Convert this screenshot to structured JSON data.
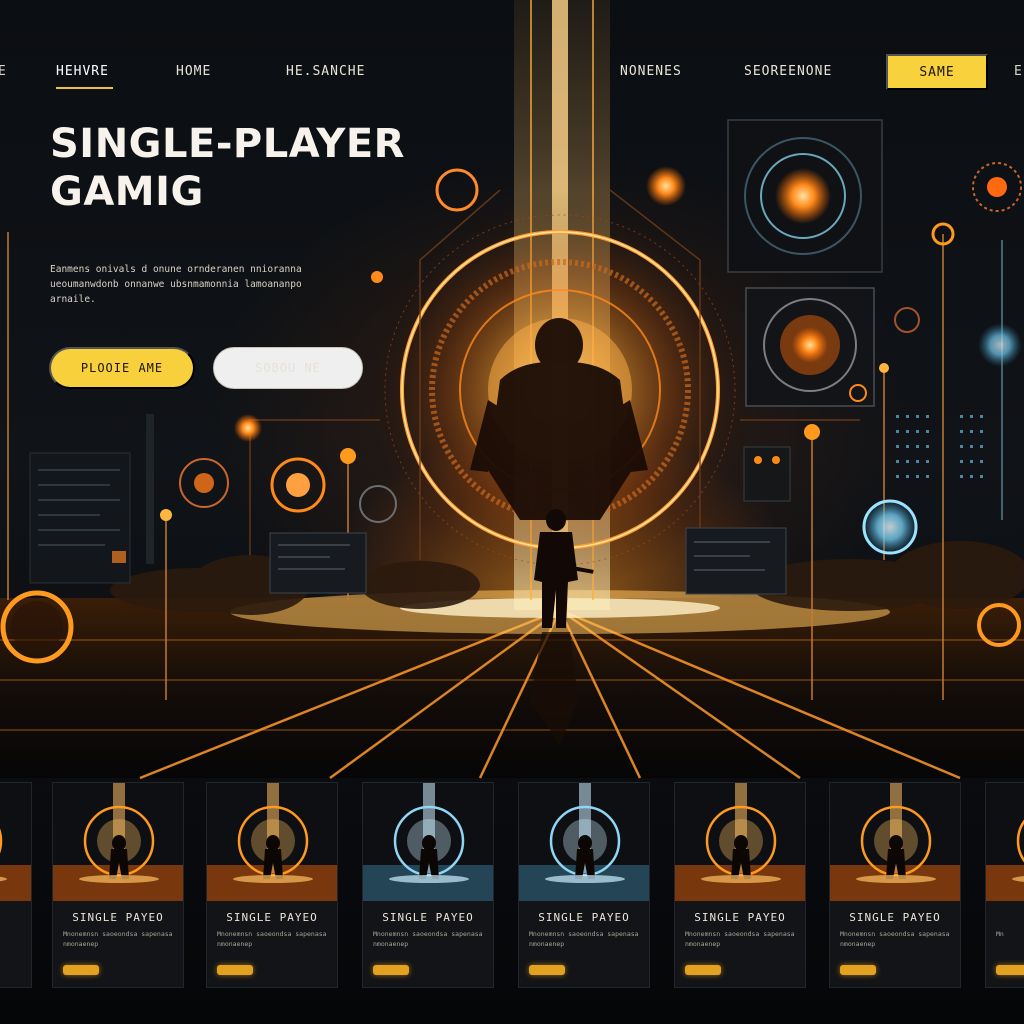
{
  "nav": {
    "left_edge": "E",
    "items": [
      {
        "label": "HEHVRE",
        "active": true
      },
      {
        "label": "HOME",
        "active": false
      },
      {
        "label": "HE.SANCHE",
        "active": false
      },
      {
        "label": "NONENES",
        "active": false
      },
      {
        "label": "SEOREENONE",
        "active": false
      }
    ],
    "cta": "SAME",
    "right_edge": "E"
  },
  "hero": {
    "title_line1": "SINGLE-PLAYER",
    "title_line2": "GAMIG",
    "description": "Eanmens onivals d onune ornderanen nnioranna ueoumanwdonb onnanwe ubsnmamonnia lamoananpo arnaile.",
    "primary_button": "PLOOIE AME",
    "secondary_button": "SOBOU NE"
  },
  "cards": [
    {
      "title": "",
      "theme": "orange",
      "text": "",
      "partial": "left"
    },
    {
      "title": "SINGLE PAYEO",
      "theme": "orange",
      "text": "Mnonemnsn saoeondsa sapenasa nmonaenep"
    },
    {
      "title": "SINGLE PAYEO",
      "theme": "orange",
      "text": "Mnonemnsn saoeondsa sapenasa nmonaenep"
    },
    {
      "title": "SINGLE PAYEO",
      "theme": "blue",
      "text": "Mnonemnsn saoeondsa sapenasa nmonaenep"
    },
    {
      "title": "SINGLE PAYEO",
      "theme": "blue",
      "text": "Mnonemnsn saoeondsa sapenasa nmonaenep"
    },
    {
      "title": "SINGLE PAYEO",
      "theme": "orange",
      "text": "Mnonemnsn saoeondsa sapenasa nmonaenep"
    },
    {
      "title": "SINGLE PAYEO",
      "theme": "orange",
      "text": "Mnonemnsn saoeondsa sapenasa nmonaenep"
    },
    {
      "title": "S",
      "theme": "orange",
      "text": "Mn",
      "partial": "right"
    }
  ],
  "colors": {
    "accent": "#f7d03c",
    "glow": "#ff9a1f",
    "blue_glow": "#7fd8ff",
    "background": "#07090c"
  },
  "icons": [
    "glowing-ring-icon",
    "orb-icon",
    "reticle-icon"
  ]
}
